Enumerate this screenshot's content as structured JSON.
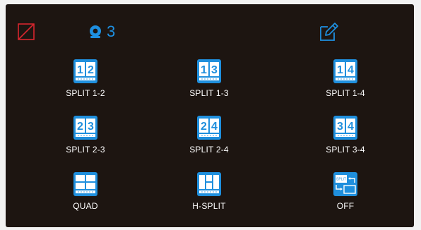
{
  "status": {
    "no_signal_icon": "no-signal-icon",
    "camera_icon": "camera-icon",
    "camera_count": "3",
    "edit_icon": "edit-icon"
  },
  "modes": [
    {
      "label": "SPLIT 1-2",
      "digits": [
        "1",
        "2"
      ],
      "icon": "split-1-2-icon"
    },
    {
      "label": "SPLIT 1-3",
      "digits": [
        "1",
        "3"
      ],
      "icon": "split-1-3-icon"
    },
    {
      "label": "SPLIT 1-4",
      "digits": [
        "1",
        "4"
      ],
      "icon": "split-1-4-icon"
    },
    {
      "label": "SPLIT 2-3",
      "digits": [
        "2",
        "3"
      ],
      "icon": "split-2-3-icon"
    },
    {
      "label": "SPLIT 2-4",
      "digits": [
        "2",
        "4"
      ],
      "icon": "split-2-4-icon"
    },
    {
      "label": "SPLIT 3-4",
      "digits": [
        "3",
        "4"
      ],
      "icon": "split-3-4-icon"
    },
    {
      "label": "QUAD",
      "digits": [],
      "icon": "quad-icon"
    },
    {
      "label": "H-SPLIT",
      "digits": [],
      "icon": "h-split-icon"
    },
    {
      "label": "OFF",
      "digits": [],
      "icon": "split-off-icon",
      "icon_text": "SPLIT"
    }
  ],
  "colors": {
    "background": "#1d1511",
    "accent": "#1f8fdd",
    "no_signal": "#d8262e",
    "label": "#ffffff"
  }
}
